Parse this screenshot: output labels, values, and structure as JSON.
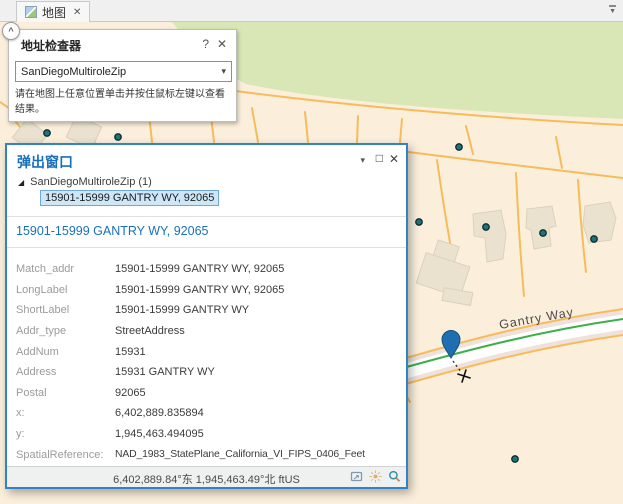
{
  "tab_bar": {
    "tab_label": "地图"
  },
  "inspector": {
    "title": "地址检查器",
    "locator_value": "SanDiegoMultiroleZip",
    "instruction_line1": "请在地图上任意位置单击并按住鼠标左键以查看",
    "instruction_line2": "结果。"
  },
  "popup": {
    "title": "弹出窗口",
    "layer_item": "SanDiegoMultiroleZip  (1)",
    "selected_feature": "15901-15999 GANTRY WY, 92065",
    "heading": "15901-15999 GANTRY WY, 92065",
    "attributes": [
      {
        "label": "Match_addr",
        "value": "15901-15999 GANTRY WY, 92065"
      },
      {
        "label": "LongLabel",
        "value": "15901-15999 GANTRY WY, 92065"
      },
      {
        "label": "ShortLabel",
        "value": "15901-15999 GANTRY WY"
      },
      {
        "label": "Addr_type",
        "value": "StreetAddress"
      },
      {
        "label": "AddNum",
        "value": "15931"
      },
      {
        "label": "Address",
        "value": "15931 GANTRY WY"
      },
      {
        "label": "Postal",
        "value": "92065"
      },
      {
        "label": "x:",
        "value": "6,402,889.835894"
      },
      {
        "label": "y:",
        "value": "1,945,463.494095"
      },
      {
        "label": "SpatialReference:",
        "value": "NAD_1983_StatePlane_California_VI_FIPS_0406_Feet"
      }
    ],
    "status_text": "6,402,889.84°东 1,945,463.49°北 ftUS"
  },
  "map": {
    "street_label": "Gantry Way",
    "colors": {
      "background": "#fbefdc",
      "park": "#d9e7b6",
      "parcel_line": "#f6bc5c",
      "building_fill": "#eae2cf",
      "building_stroke": "#dbd2ba",
      "road_fill": "#ffffff",
      "road_edge": "#efe1db",
      "street_line": "#3dae49",
      "address_point": "#1b757d",
      "pin": "#1d6fb0"
    }
  },
  "icons": {
    "tab_close": "✕",
    "tab_pin": "▼",
    "collapse": "^",
    "help": "?",
    "inspector_close": "✕",
    "combo_caret": "▾",
    "popup_caret": "▾",
    "popup_maximize": "□",
    "popup_close": "✕",
    "tree_expander": "◢",
    "pan_to": "rect-with-arrow-shape",
    "flash_location": "sun-burst-shape",
    "zoom_to": "magnifier-shape"
  },
  "colors": {
    "accent_blue": "#1a70ba",
    "popup_border": "#3182c8",
    "selection_bg": "#cde7f8",
    "selection_border": "#6fa8d4"
  }
}
